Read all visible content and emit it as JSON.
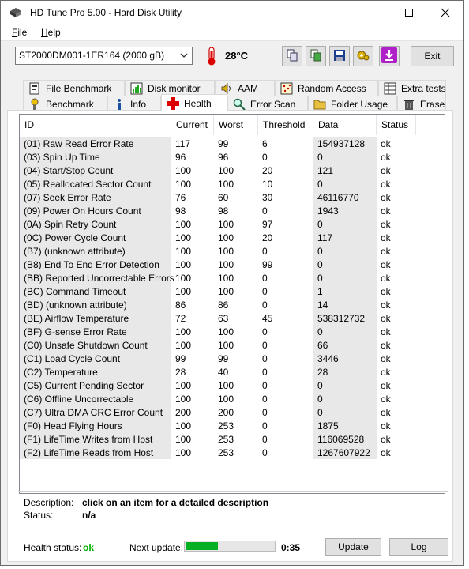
{
  "window": {
    "title": "HD Tune Pro 5.00 - Hard Disk Utility"
  },
  "menu": {
    "file": "File",
    "file_mnemonic": "F",
    "file_rest": "ile",
    "help": "Help",
    "help_mnemonic": "H",
    "help_rest": "elp"
  },
  "toolbar": {
    "drive": "ST2000DM001-1ER164 (2000 gB)",
    "temperature": "28°C",
    "exit_label": "Exit",
    "icons": [
      "copy-icon",
      "copy-screenshot-icon",
      "save-icon",
      "options-icon",
      "download-icon"
    ]
  },
  "tabs_top": [
    {
      "label": "File Benchmark",
      "icon": "file-benchmark-icon"
    },
    {
      "label": "Disk monitor",
      "icon": "disk-monitor-icon"
    },
    {
      "label": "AAM",
      "icon": "speaker-icon"
    },
    {
      "label": "Random Access",
      "icon": "random-access-icon"
    },
    {
      "label": "Extra tests",
      "icon": "extra-tests-icon"
    }
  ],
  "tabs_bottom": [
    {
      "label": "Benchmark",
      "icon": "benchmark-icon"
    },
    {
      "label": "Info",
      "icon": "info-icon"
    },
    {
      "label": "Health",
      "icon": "health-cross-icon",
      "active": true
    },
    {
      "label": "Error Scan",
      "icon": "error-scan-icon"
    },
    {
      "label": "Folder Usage",
      "icon": "folder-icon"
    },
    {
      "label": "Erase",
      "icon": "trash-icon"
    }
  ],
  "table": {
    "columns": [
      "ID",
      "Current",
      "Worst",
      "Threshold",
      "Data",
      "Status"
    ],
    "rows": [
      [
        "(01) Raw Read Error Rate",
        "117",
        "99",
        "6",
        "154937128",
        "ok"
      ],
      [
        "(03) Spin Up Time",
        "96",
        "96",
        "0",
        "0",
        "ok"
      ],
      [
        "(04) Start/Stop Count",
        "100",
        "100",
        "20",
        "121",
        "ok"
      ],
      [
        "(05) Reallocated Sector Count",
        "100",
        "100",
        "10",
        "0",
        "ok"
      ],
      [
        "(07) Seek Error Rate",
        "76",
        "60",
        "30",
        "46116770",
        "ok"
      ],
      [
        "(09) Power On Hours Count",
        "98",
        "98",
        "0",
        "1943",
        "ok"
      ],
      [
        "(0A) Spin Retry Count",
        "100",
        "100",
        "97",
        "0",
        "ok"
      ],
      [
        "(0C) Power Cycle Count",
        "100",
        "100",
        "20",
        "117",
        "ok"
      ],
      [
        "(B7) (unknown attribute)",
        "100",
        "100",
        "0",
        "0",
        "ok"
      ],
      [
        "(B8) End To End Error Detection",
        "100",
        "100",
        "99",
        "0",
        "ok"
      ],
      [
        "(BB) Reported Uncorrectable Errors",
        "100",
        "100",
        "0",
        "0",
        "ok"
      ],
      [
        "(BC) Command Timeout",
        "100",
        "100",
        "0",
        "1",
        "ok"
      ],
      [
        "(BD) (unknown attribute)",
        "86",
        "86",
        "0",
        "14",
        "ok"
      ],
      [
        "(BE) Airflow Temperature",
        "72",
        "63",
        "45",
        "538312732",
        "ok"
      ],
      [
        "(BF) G-sense Error Rate",
        "100",
        "100",
        "0",
        "0",
        "ok"
      ],
      [
        "(C0) Unsafe Shutdown Count",
        "100",
        "100",
        "0",
        "66",
        "ok"
      ],
      [
        "(C1) Load Cycle Count",
        "99",
        "99",
        "0",
        "3446",
        "ok"
      ],
      [
        "(C2) Temperature",
        "28",
        "40",
        "0",
        "28",
        "ok"
      ],
      [
        "(C5) Current Pending Sector",
        "100",
        "100",
        "0",
        "0",
        "ok"
      ],
      [
        "(C6) Offline Uncorrectable",
        "100",
        "100",
        "0",
        "0",
        "ok"
      ],
      [
        "(C7) Ultra DMA CRC Error Count",
        "200",
        "200",
        "0",
        "0",
        "ok"
      ],
      [
        "(F0) Head Flying Hours",
        "100",
        "253",
        "0",
        "1875",
        "ok"
      ],
      [
        "(F1) LifeTime Writes from Host",
        "100",
        "253",
        "0",
        "116069528",
        "ok"
      ],
      [
        "(F2) LifeTime Reads from Host",
        "100",
        "253",
        "0",
        "1267607922",
        "ok"
      ]
    ]
  },
  "description": {
    "desc_label": "Description:",
    "desc_value": "click on an item for a detailed description",
    "status_label": "Status:",
    "status_value": "n/a"
  },
  "footer": {
    "health_label": "Health status:",
    "health_value": "ok",
    "health_color": "#00b000",
    "next_update_label": "Next update:",
    "progress_fraction": 0.38,
    "countdown": "0:35",
    "update_label": "Update",
    "log_label": "Log"
  }
}
